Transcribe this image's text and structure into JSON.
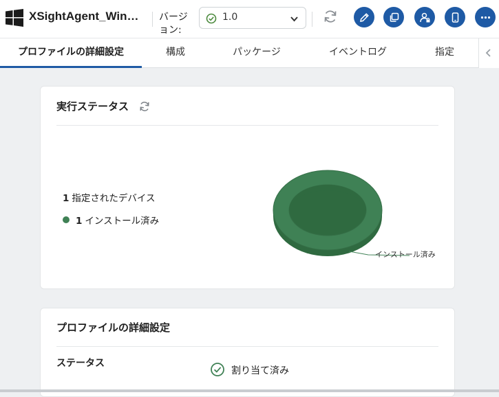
{
  "header": {
    "app_title": "XSightAgent_Win…",
    "version_label": "バージョン:",
    "version_value": "1.0",
    "icons": [
      "windows-logo-icon",
      "check-circle-icon",
      "chevron-down-icon",
      "refresh-icon",
      "pencil-icon",
      "copy-icon",
      "user-assign-icon",
      "mobile-device-icon",
      "more-icon"
    ],
    "accent_color": "#1e5aa5"
  },
  "tabs": [
    {
      "label": "プロファイルの詳細設定",
      "active": true
    },
    {
      "label": "構成",
      "active": false
    },
    {
      "label": "パッケージ",
      "active": false
    },
    {
      "label": "イベントログ",
      "active": false
    },
    {
      "label": "指定",
      "active": false
    }
  ],
  "execution_status": {
    "title": "実行ステータス",
    "assigned_count": "1",
    "assigned_label": "指定されたデバイス",
    "installed_count": "1",
    "installed_label": "インストール済み",
    "donut_label": "インストール済み",
    "installed_color": "#3f8155"
  },
  "profile_details": {
    "title": "プロファイルの詳細設定",
    "status_label": "ステータス",
    "status_value": "割り当て済み",
    "status_color": "#3f8155"
  }
}
